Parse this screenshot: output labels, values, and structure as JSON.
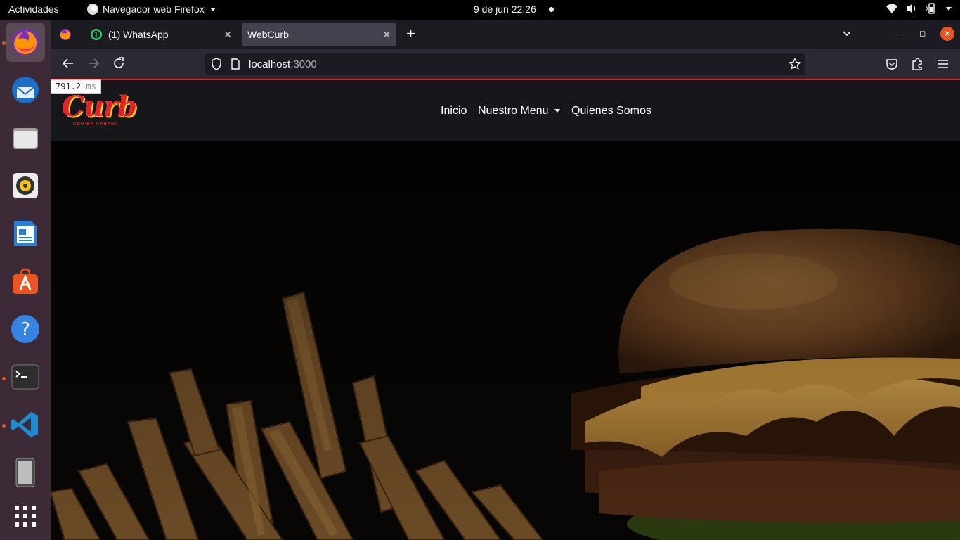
{
  "topbar": {
    "activities": "Actividades",
    "app_name": "Navegador web Firefox",
    "clock": "9 de jun  22:26"
  },
  "dock": {
    "items": [
      {
        "name": "firefox",
        "active": true
      },
      {
        "name": "thunderbird"
      },
      {
        "name": "files"
      },
      {
        "name": "rhythmbox"
      },
      {
        "name": "libreoffice-writer"
      },
      {
        "name": "ubuntu-software"
      },
      {
        "name": "help"
      },
      {
        "name": "terminal"
      },
      {
        "name": "vscode"
      },
      {
        "name": "removable-device"
      },
      {
        "name": "show-applications"
      }
    ]
  },
  "browser": {
    "tabs": [
      {
        "label": "(1) WhatsApp",
        "badge": "1"
      },
      {
        "label": "WebCurb",
        "active": true
      }
    ],
    "url_host": "localhost",
    "url_port": ":3000",
    "accent_color": "#e0272e"
  },
  "perf_badge": {
    "value": "791.2",
    "unit": "ms"
  },
  "site": {
    "logo_word": "Curb",
    "logo_sub": "COMIDA URBANA",
    "nav": {
      "home": "Inicio",
      "menu": "Nuestro Menu",
      "about": "Quienes Somos"
    },
    "brand_color": "#e8202a"
  }
}
